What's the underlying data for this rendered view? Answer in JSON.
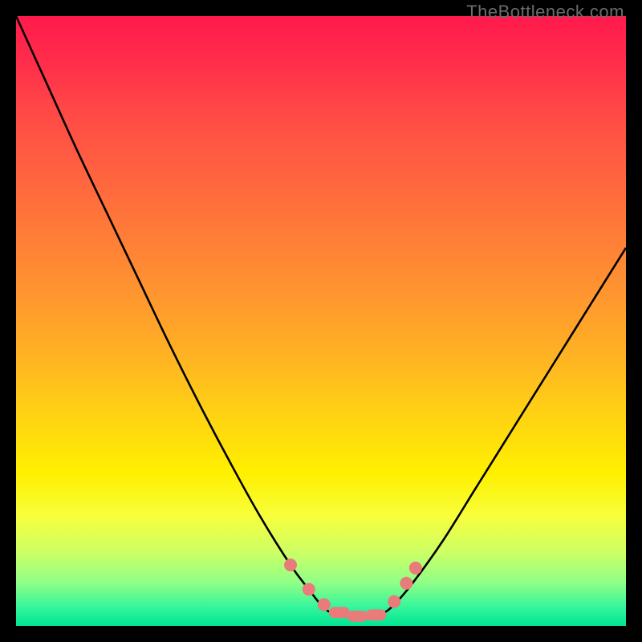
{
  "watermark": "TheBottleneck.com",
  "chart_data": {
    "type": "line",
    "title": "",
    "xlabel": "",
    "ylabel": "",
    "xlim": [
      0,
      100
    ],
    "ylim": [
      0,
      100
    ],
    "series": [
      {
        "name": "bottleneck-curve",
        "x": [
          0,
          5,
          10,
          15,
          20,
          25,
          30,
          35,
          40,
          45,
          48,
          50,
          52,
          55,
          58,
          60,
          62,
          65,
          70,
          75,
          80,
          85,
          90,
          95,
          100
        ],
        "values": [
          100,
          89,
          78,
          67.5,
          57,
          46.5,
          36.5,
          27,
          18,
          10,
          6,
          3.5,
          2,
          1.5,
          1.5,
          2,
          3.5,
          7,
          14,
          22,
          30,
          38,
          46,
          54,
          62
        ]
      }
    ],
    "markers": [
      {
        "x": 45,
        "y": 10,
        "shape": "dot"
      },
      {
        "x": 48,
        "y": 6,
        "shape": "dot"
      },
      {
        "x": 50.5,
        "y": 3.5,
        "shape": "dot"
      },
      {
        "x": 53,
        "y": 2.2,
        "shape": "pill"
      },
      {
        "x": 56,
        "y": 1.6,
        "shape": "pill"
      },
      {
        "x": 59,
        "y": 1.8,
        "shape": "pill"
      },
      {
        "x": 62,
        "y": 4,
        "shape": "dot"
      },
      {
        "x": 64,
        "y": 7,
        "shape": "dot"
      },
      {
        "x": 65.5,
        "y": 9.5,
        "shape": "dot"
      }
    ],
    "colors": {
      "curve": "#000000",
      "marker": "#e97b7b",
      "background_top": "#ff1a4d",
      "background_bottom": "#00e592"
    }
  }
}
